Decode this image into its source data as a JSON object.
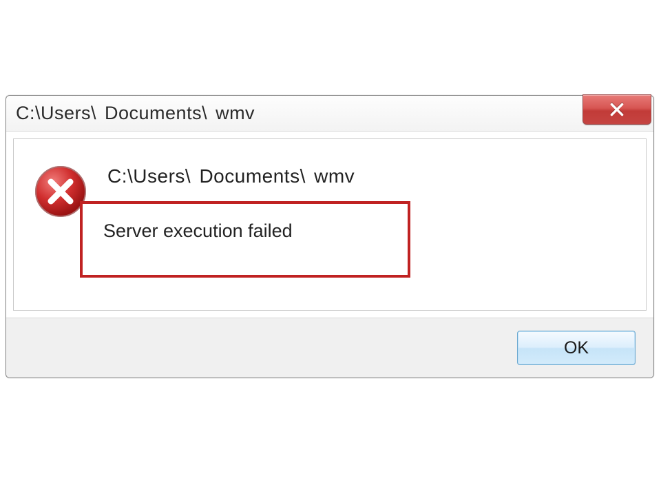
{
  "titlebar": {
    "text": "C:\\Users\\ Documents\\  wmv"
  },
  "body": {
    "path_line": "C:\\Users\\ Documents\\  wmv",
    "error_message": "Server execution failed"
  },
  "footer": {
    "ok_label": "OK"
  }
}
